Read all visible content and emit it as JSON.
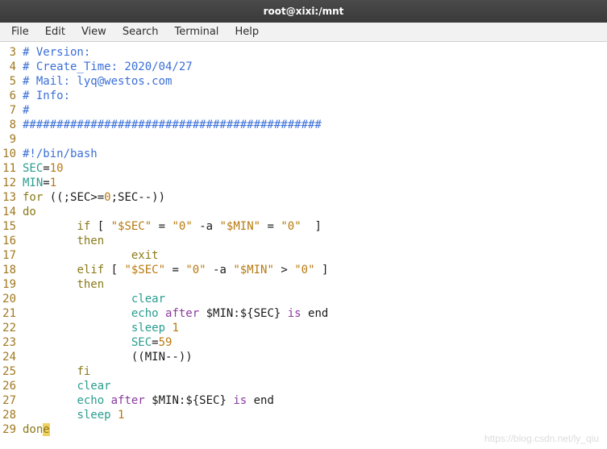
{
  "window": {
    "title": "root@xixi:/mnt"
  },
  "menubar": {
    "items": [
      "File",
      "Edit",
      "View",
      "Search",
      "Terminal",
      "Help"
    ]
  },
  "watermark": "https://blog.csdn.net/ly_qiu",
  "lines": [
    {
      "n": 3,
      "html": "<span class='c-comment'># Version:</span>"
    },
    {
      "n": 4,
      "html": "<span class='c-comment'># Create_Time: 2020/04/27</span>"
    },
    {
      "n": 5,
      "html": "<span class='c-comment'># Mail: lyq@westos.com</span>"
    },
    {
      "n": 6,
      "html": "<span class='c-comment'># Info:</span>"
    },
    {
      "n": 7,
      "html": "<span class='c-comment'>#</span>"
    },
    {
      "n": 8,
      "html": "<span class='c-comment'>############################################</span>"
    },
    {
      "n": 9,
      "html": ""
    },
    {
      "n": 10,
      "html": "<span class='c-shebang'>#!/bin/bash</span>"
    },
    {
      "n": 11,
      "html": "<span class='c-teal'>SEC</span><span class='c-default'>=</span><span class='c-num'>10</span>"
    },
    {
      "n": 12,
      "html": "<span class='c-teal'>MIN</span><span class='c-default'>=</span><span class='c-num'>1</span>"
    },
    {
      "n": 13,
      "html": "<span class='c-olive'>for</span><span class='c-default'> ((;SEC&gt;=</span><span class='c-num'>0</span><span class='c-default'>;SEC--))</span>"
    },
    {
      "n": 14,
      "html": "<span class='c-olive'>do</span>"
    },
    {
      "n": 15,
      "html": "<span class='c-default'>        </span><span class='c-olive'>if</span><span class='c-default'> [ </span><span class='c-str'>\"$SEC\"</span><span class='c-default'> = </span><span class='c-str'>\"0\"</span><span class='c-default'> -a </span><span class='c-str'>\"$MIN\"</span><span class='c-default'> = </span><span class='c-str'>\"0\"</span><span class='c-default'>  ]</span>"
    },
    {
      "n": 16,
      "html": "<span class='c-default'>        </span><span class='c-olive'>then</span>"
    },
    {
      "n": 17,
      "html": "<span class='c-default'>                </span><span class='c-olive'>exit</span>"
    },
    {
      "n": 18,
      "html": "<span class='c-default'>        </span><span class='c-olive'>elif</span><span class='c-default'> [ </span><span class='c-str'>\"$SEC\"</span><span class='c-default'> = </span><span class='c-str'>\"0\"</span><span class='c-default'> -a </span><span class='c-str'>\"$MIN\"</span><span class='c-default'> &gt; </span><span class='c-str'>\"0\"</span><span class='c-default'> ]</span>"
    },
    {
      "n": 19,
      "html": "<span class='c-default'>        </span><span class='c-olive'>then</span>"
    },
    {
      "n": 20,
      "html": "<span class='c-default'>                </span><span class='c-teal'>clear</span>"
    },
    {
      "n": 21,
      "html": "<span class='c-default'>                </span><span class='c-teal'>echo</span><span class='c-default'> </span><span class='c-purple'>after</span><span class='c-default'> $MIN:${SEC} </span><span class='c-purple'>is</span><span class='c-default'> end</span>"
    },
    {
      "n": 22,
      "html": "<span class='c-default'>                </span><span class='c-teal'>sleep</span><span class='c-default'> </span><span class='c-num'>1</span>"
    },
    {
      "n": 23,
      "html": "<span class='c-default'>                </span><span class='c-teal'>SEC</span><span class='c-default'>=</span><span class='c-num'>59</span>"
    },
    {
      "n": 24,
      "html": "<span class='c-default'>                ((MIN--))</span>"
    },
    {
      "n": 25,
      "html": "<span class='c-default'>        </span><span class='c-olive'>fi</span>"
    },
    {
      "n": 26,
      "html": "<span class='c-default'>        </span><span class='c-teal'>clear</span>"
    },
    {
      "n": 27,
      "html": "<span class='c-default'>        </span><span class='c-teal'>echo</span><span class='c-default'> </span><span class='c-purple'>after</span><span class='c-default'> $MIN:${SEC} </span><span class='c-purple'>is</span><span class='c-default'> end</span>"
    },
    {
      "n": 28,
      "html": "<span class='c-default'>        </span><span class='c-teal'>sleep</span><span class='c-default'> </span><span class='c-num'>1</span>"
    },
    {
      "n": 29,
      "html": "<span class='c-olive'>don</span><span class='c-olive cursor'>e</span>"
    }
  ]
}
